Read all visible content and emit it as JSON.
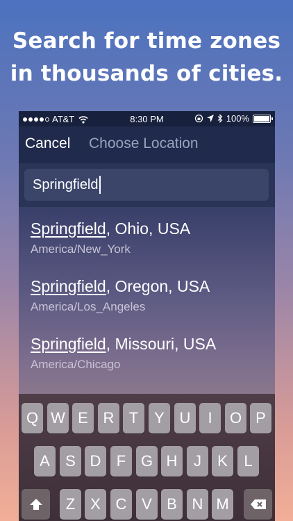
{
  "headline": {
    "line1": "Search for time zones",
    "line2": "in thousands of cities."
  },
  "statusbar": {
    "carrier": "AT&T",
    "time": "8:30 PM",
    "battery": "100%",
    "icons": [
      "signal-dots-icon",
      "wifi-icon",
      "lock-rotation-icon",
      "location-arrow-icon",
      "bluetooth-icon",
      "battery-icon"
    ]
  },
  "navbar": {
    "cancel_label": "Cancel",
    "title": "Choose Location"
  },
  "search": {
    "value": "Springfield"
  },
  "results": [
    {
      "match": "Springfield",
      "rest": ", Ohio, USA",
      "tz": "America/New_York"
    },
    {
      "match": "Springfield",
      "rest": ", Oregon, USA",
      "tz": "America/Los_Angeles"
    },
    {
      "match": "Springfield",
      "rest": ", Missouri, USA",
      "tz": "America/Chicago"
    }
  ],
  "keyboard": {
    "row1": [
      "Q",
      "W",
      "E",
      "R",
      "T",
      "Y",
      "U",
      "I",
      "O",
      "P"
    ],
    "row2": [
      "A",
      "S",
      "D",
      "F",
      "G",
      "H",
      "J",
      "K",
      "L"
    ],
    "row3": [
      "Z",
      "X",
      "C",
      "V",
      "B",
      "N",
      "M"
    ],
    "shift_icon": "shift-icon",
    "delete_icon": "delete-icon"
  }
}
